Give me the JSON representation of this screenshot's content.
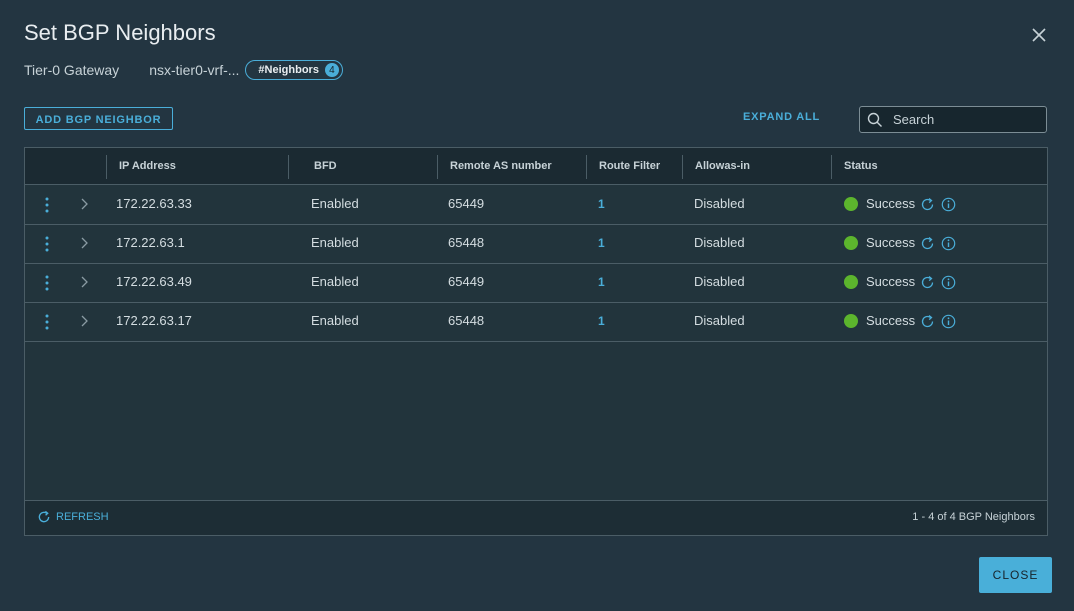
{
  "dialog": {
    "title": "Set BGP Neighbors",
    "gateway_label": "Tier-0 Gateway",
    "gateway_name": "nsx-tier0-vrf-...",
    "neighbors_badge": {
      "label": "#Neighbors",
      "count": "4"
    }
  },
  "toolbar": {
    "add_label": "ADD BGP NEIGHBOR",
    "expand_all_label": "EXPAND ALL",
    "search_placeholder": "Search"
  },
  "table": {
    "columns": [
      "IP Address",
      "BFD",
      "Remote AS number",
      "Route Filter",
      "Allowas-in",
      "Status"
    ],
    "rows": [
      {
        "ip": "172.22.63.33",
        "bfd": "Enabled",
        "remote_as": "65449",
        "route_filter": "1",
        "allowas_in": "Disabled",
        "status": "Success"
      },
      {
        "ip": "172.22.63.1",
        "bfd": "Enabled",
        "remote_as": "65448",
        "route_filter": "1",
        "allowas_in": "Disabled",
        "status": "Success"
      },
      {
        "ip": "172.22.63.49",
        "bfd": "Enabled",
        "remote_as": "65449",
        "route_filter": "1",
        "allowas_in": "Disabled",
        "status": "Success"
      },
      {
        "ip": "172.22.63.17",
        "bfd": "Enabled",
        "remote_as": "65448",
        "route_filter": "1",
        "allowas_in": "Disabled",
        "status": "Success"
      }
    ]
  },
  "footer": {
    "refresh_label": "REFRESH",
    "pagination": "1 - 4 of 4 BGP Neighbors"
  },
  "actions": {
    "close_label": "CLOSE"
  },
  "colors": {
    "accent": "#49afd9",
    "success": "#5cb52d",
    "background": "#233541"
  }
}
